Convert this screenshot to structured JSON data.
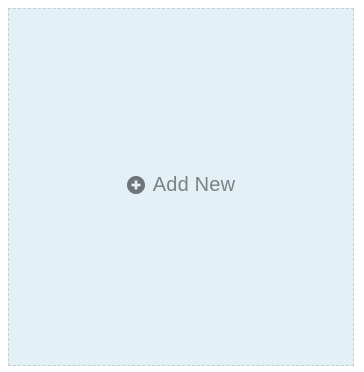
{
  "add_card": {
    "label": "Add New",
    "icon": "plus-circle-icon"
  }
}
